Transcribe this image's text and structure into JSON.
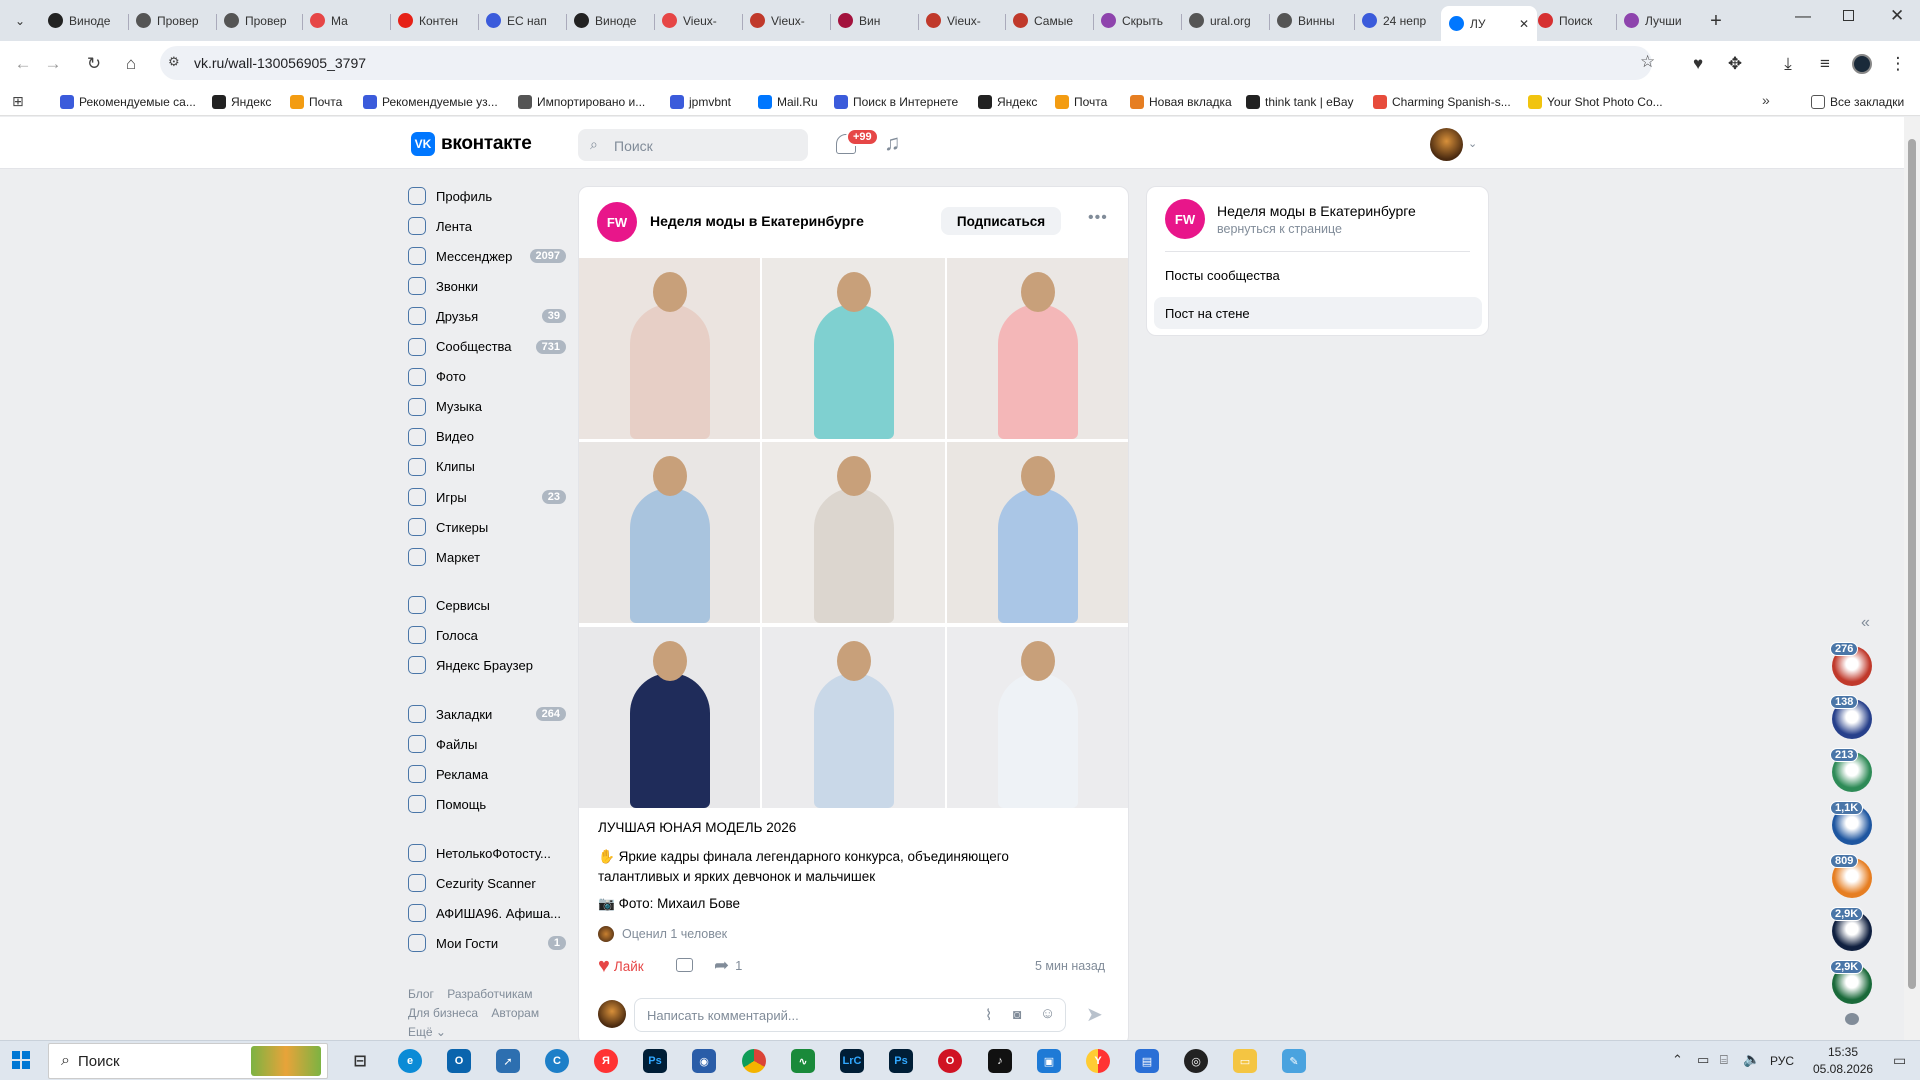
{
  "browser": {
    "tabs": [
      {
        "label": "Виноде",
        "color": "#222"
      },
      {
        "label": "Провер",
        "color": "#555"
      },
      {
        "label": "Провер",
        "color": "#555"
      },
      {
        "label": "Ма",
        "color": "#e64646"
      },
      {
        "label": "Контен",
        "color": "#e62117"
      },
      {
        "label": "ЕС нап",
        "color": "#3b5bdb"
      },
      {
        "label": "Виноде",
        "color": "#222"
      },
      {
        "label": "Vieux-",
        "color": "#e64646"
      },
      {
        "label": "Vieux-",
        "color": "#c0392b"
      },
      {
        "label": "Вин",
        "color": "#a3123d"
      },
      {
        "label": "Vieux-",
        "color": "#c0392b"
      },
      {
        "label": "Самые",
        "color": "#c0392b"
      },
      {
        "label": "Скрыть",
        "color": "#8e44ad"
      },
      {
        "label": "ural.org",
        "color": "#555"
      },
      {
        "label": "Винны",
        "color": "#555"
      },
      {
        "label": "24 непр",
        "color": "#3b5bdb"
      },
      {
        "label": "ЛУ",
        "color": "#0077ff"
      },
      {
        "label": "Поиск",
        "color": "#d63031"
      },
      {
        "label": "Лучши",
        "color": "#8e44ad"
      }
    ],
    "url": "vk.ru/wall-130056905_3797",
    "bookmarks": [
      {
        "label": "Рекомендуемые са...",
        "color": "#3b5bdb"
      },
      {
        "label": "Яндекс",
        "color": "#222"
      },
      {
        "label": "Почта",
        "color": "#f39c12"
      },
      {
        "label": "Рекомендуемые уз...",
        "color": "#3b5bdb"
      },
      {
        "label": "Импортировано и...",
        "color": "#555"
      },
      {
        "label": "jpmvbnt",
        "color": "#3b5bdb"
      },
      {
        "label": "Mail.Ru",
        "color": "#0077ff"
      },
      {
        "label": "Поиск в Интернете",
        "color": "#3b5bdb"
      },
      {
        "label": "Яндекс",
        "color": "#222"
      },
      {
        "label": "Почта",
        "color": "#f39c12"
      },
      {
        "label": "Новая вкладка",
        "color": "#e67e22"
      },
      {
        "label": "think tank | eBay",
        "color": "#222"
      },
      {
        "label": "Charming Spanish-s...",
        "color": "#e74c3c"
      },
      {
        "label": "Your Shot Photo Co...",
        "color": "#f1c40f"
      }
    ],
    "all_bookmarks": "Все закладки"
  },
  "vk": {
    "logo_text": "вконтакте",
    "search_placeholder": "Поиск",
    "notif_count": "+99",
    "menu": [
      {
        "label": "Профиль",
        "count": ""
      },
      {
        "label": "Лента",
        "count": ""
      },
      {
        "label": "Мессенджер",
        "count": "2097"
      },
      {
        "label": "Звонки",
        "count": ""
      },
      {
        "label": "Друзья",
        "count": "39"
      },
      {
        "label": "Сообщества",
        "count": "731"
      },
      {
        "label": "Фото",
        "count": ""
      },
      {
        "label": "Музыка",
        "count": ""
      },
      {
        "label": "Видео",
        "count": ""
      },
      {
        "label": "Клипы",
        "count": ""
      },
      {
        "label": "Игры",
        "count": "23"
      },
      {
        "label": "Стикеры",
        "count": ""
      },
      {
        "label": "Маркет",
        "count": ""
      }
    ],
    "menu2": [
      {
        "label": "Сервисы"
      },
      {
        "label": "Голоса"
      },
      {
        "label": "Яндекс Браузер"
      }
    ],
    "menu3": [
      {
        "label": "Закладки",
        "count": "264"
      },
      {
        "label": "Файлы",
        "count": ""
      },
      {
        "label": "Реклама",
        "count": ""
      },
      {
        "label": "Помощь",
        "count": ""
      }
    ],
    "menu4": [
      {
        "label": "НетолькоФотосту...",
        "count": ""
      },
      {
        "label": "Cezurity Scanner",
        "count": ""
      },
      {
        "label": "АФИША96. Афиша...",
        "count": ""
      },
      {
        "label": "Мои Гости",
        "count": "1"
      }
    ],
    "footer": [
      "Блог",
      "Разработчикам",
      "Для бизнеса",
      "Авторам",
      "Ещё"
    ]
  },
  "post": {
    "community": "Неделя моды в Екатеринбурге",
    "subscribe": "Подписаться",
    "title": "ЛУЧШАЯ ЮНАЯ МОДЕЛЬ 2026",
    "text": "Яркие кадры финала легендарного конкурса, объединяющего талантливых и ярких девчонок и мальчишек",
    "photo_credit": "Фото: Михаил Бове",
    "liked_by": "Оценил 1 человек",
    "like_label": "Лайк",
    "share_count": "1",
    "time": "5 мин назад",
    "comment_placeholder": "Написать комментарий..."
  },
  "side_card": {
    "title": "Неделя моды в Екатеринбурге",
    "back": "вернуться к странице",
    "items": [
      "Посты сообщества",
      "Пост на стене"
    ]
  },
  "right_badges": [
    "276",
    "138",
    "213",
    "1,1K",
    "809",
    "2,9K",
    "2,9K"
  ],
  "taskbar": {
    "search": "Поиск",
    "lang": "РУС",
    "time": "15:35",
    "date": "05.08.2026"
  }
}
